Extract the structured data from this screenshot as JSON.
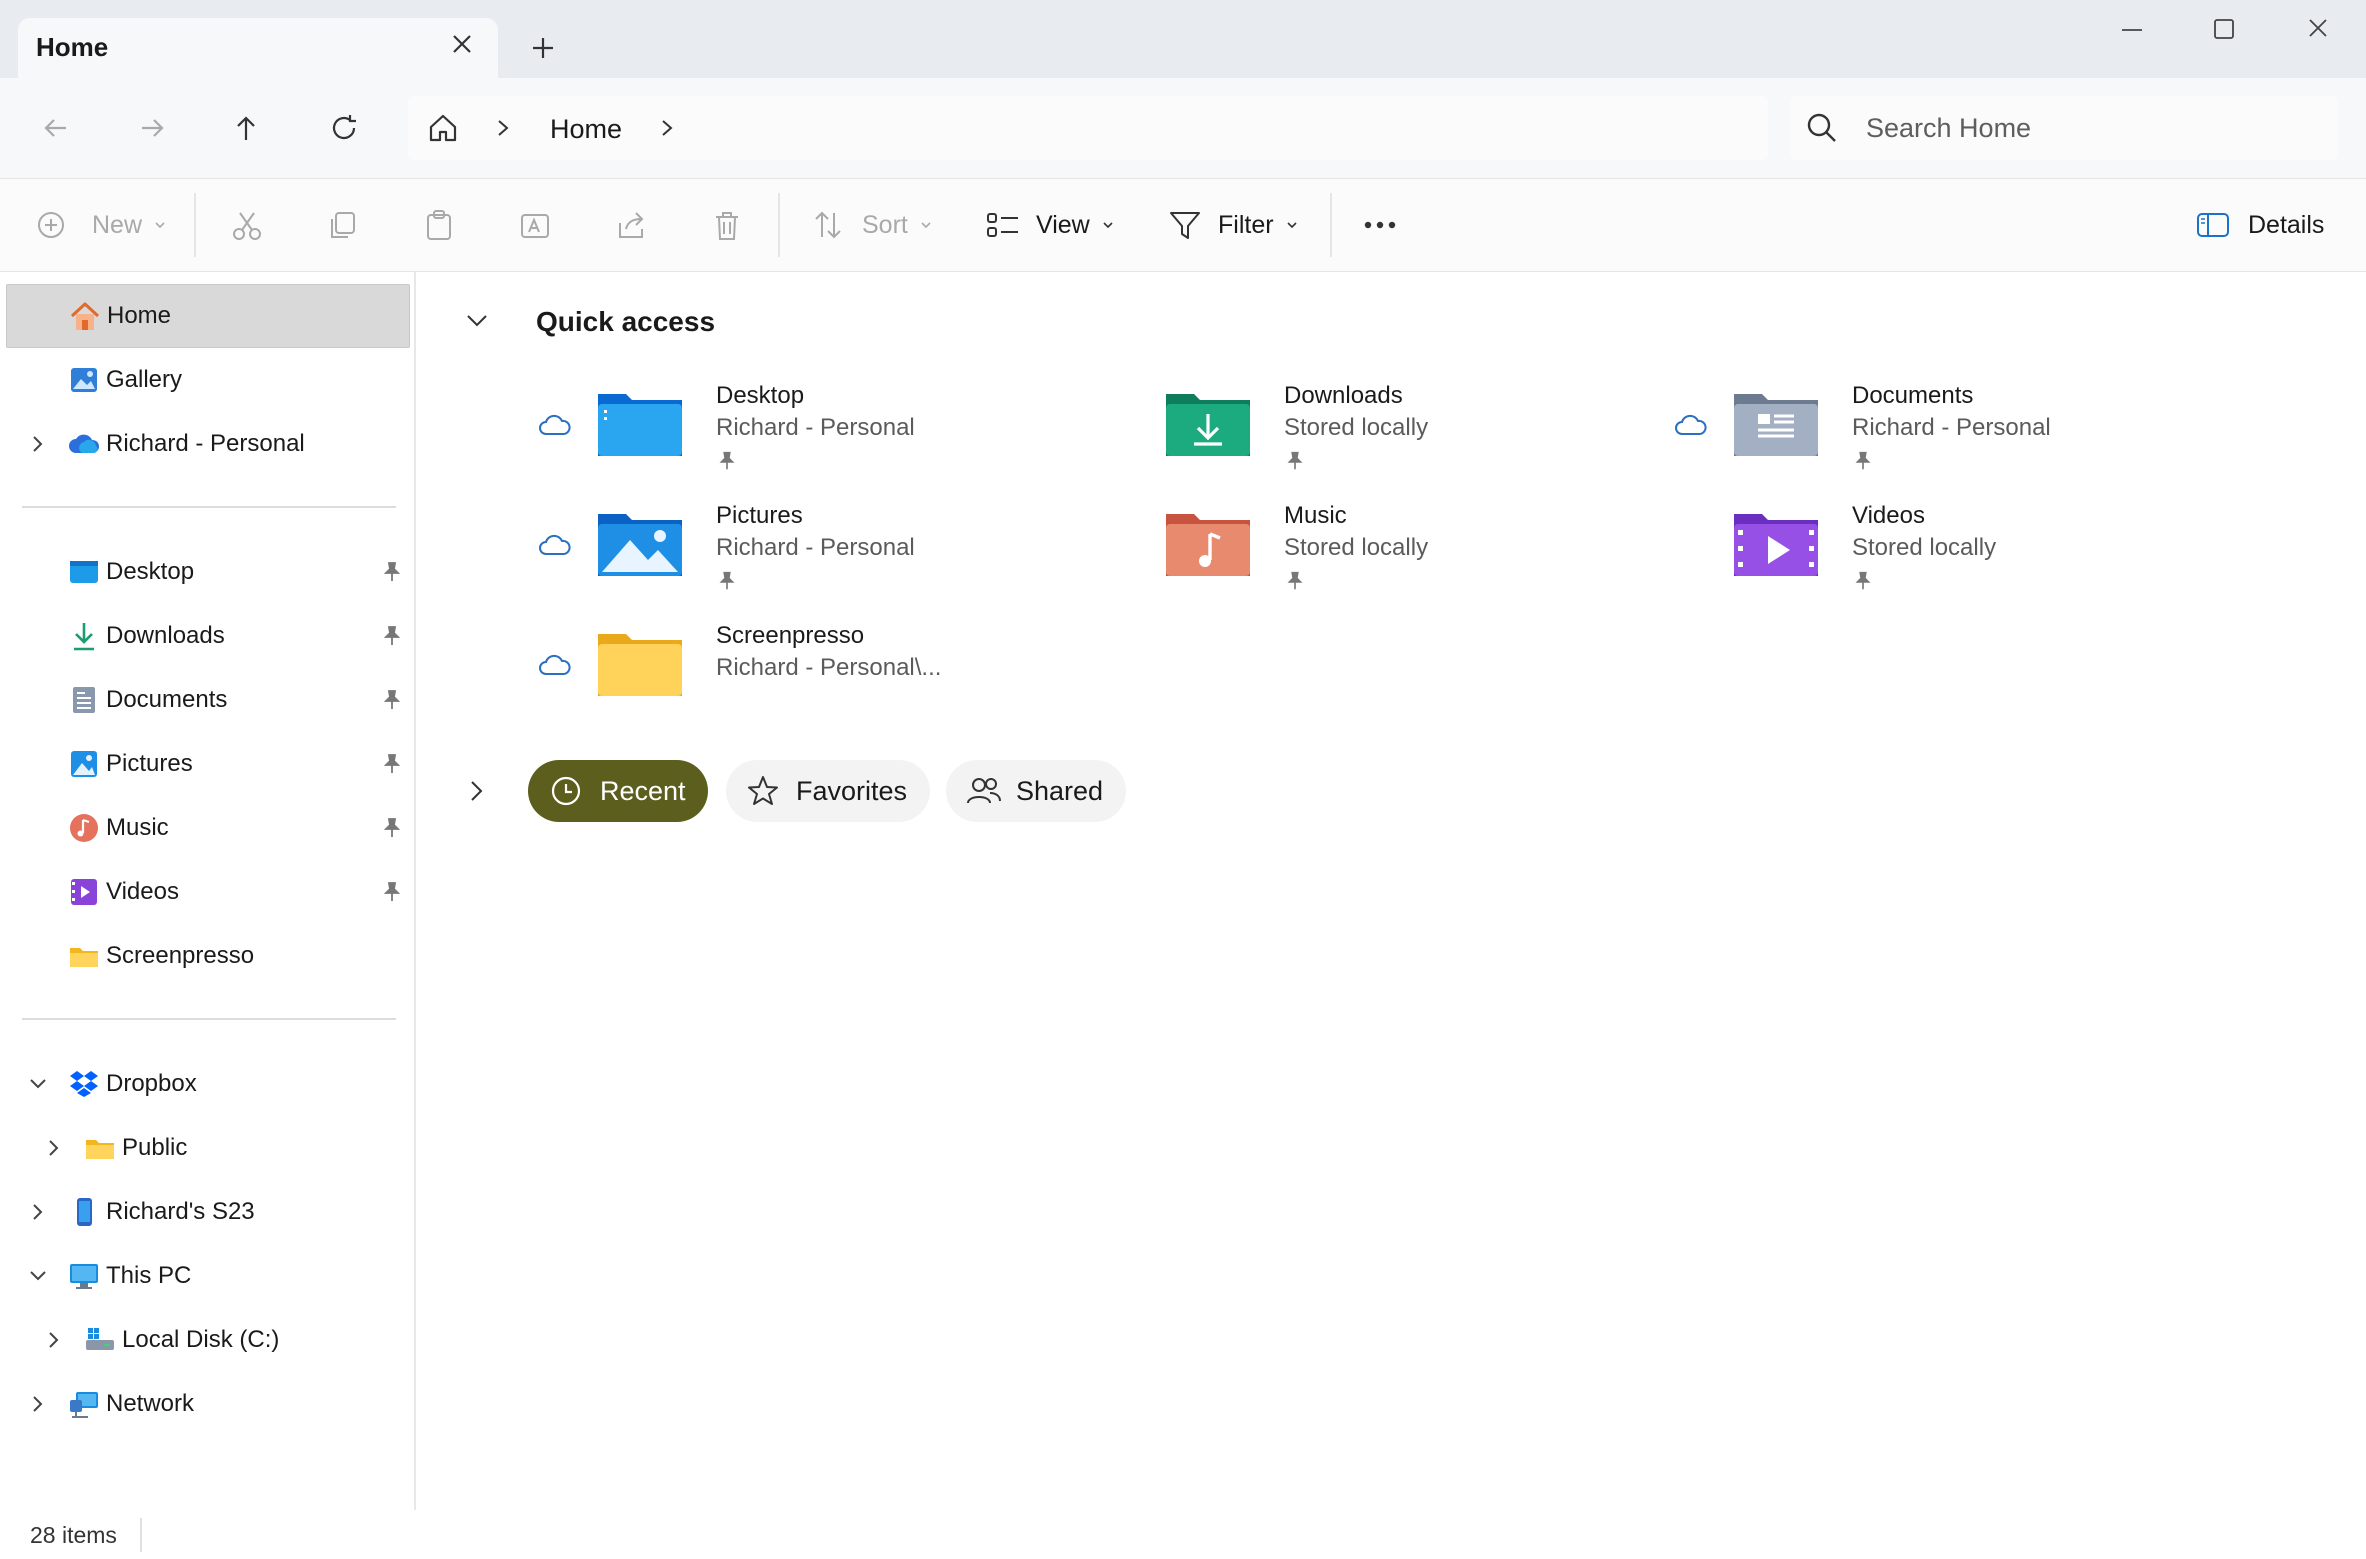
{
  "tab": {
    "title": "Home"
  },
  "address": {
    "crumb": "Home"
  },
  "search": {
    "placeholder": "Search Home"
  },
  "commands": {
    "new": "New",
    "sort": "Sort",
    "view": "View",
    "filter": "Filter",
    "details": "Details"
  },
  "sidebar": {
    "home": "Home",
    "gallery": "Gallery",
    "richard_personal": "Richard - Personal",
    "pinned": [
      {
        "label": "Desktop",
        "icon": "desktop-icon"
      },
      {
        "label": "Downloads",
        "icon": "downloads-icon"
      },
      {
        "label": "Documents",
        "icon": "documents-icon"
      },
      {
        "label": "Pictures",
        "icon": "pictures-icon"
      },
      {
        "label": "Music",
        "icon": "music-icon"
      },
      {
        "label": "Videos",
        "icon": "videos-icon"
      },
      {
        "label": "Screenpresso",
        "icon": "folder-icon"
      }
    ],
    "dropbox": "Dropbox",
    "public": "Public",
    "phone": "Richard's S23",
    "this_pc": "This PC",
    "local_disk": "Local Disk (C:)",
    "network": "Network"
  },
  "quick_access": {
    "title": "Quick access",
    "items": [
      {
        "name": "Desktop",
        "location": "Richard - Personal",
        "cloud": true,
        "pinned": true
      },
      {
        "name": "Downloads",
        "location": "Stored locally",
        "cloud": false,
        "pinned": true
      },
      {
        "name": "Documents",
        "location": "Richard - Personal",
        "cloud": true,
        "pinned": true
      },
      {
        "name": "Pictures",
        "location": "Richard - Personal",
        "cloud": true,
        "pinned": true
      },
      {
        "name": "Music",
        "location": "Stored locally",
        "cloud": false,
        "pinned": true
      },
      {
        "name": "Videos",
        "location": "Stored locally",
        "cloud": false,
        "pinned": true
      },
      {
        "name": "Screenpresso",
        "location": "Richard - Personal\\...",
        "cloud": true,
        "pinned": false
      }
    ]
  },
  "filters": {
    "recent": "Recent",
    "favorites": "Favorites",
    "shared": "Shared"
  },
  "status": {
    "items": "28 items"
  },
  "colors": {
    "active_pill": "#5b5e1c",
    "selected_nav": "#d9d9d9",
    "accent_blue": "#1a73c9"
  }
}
